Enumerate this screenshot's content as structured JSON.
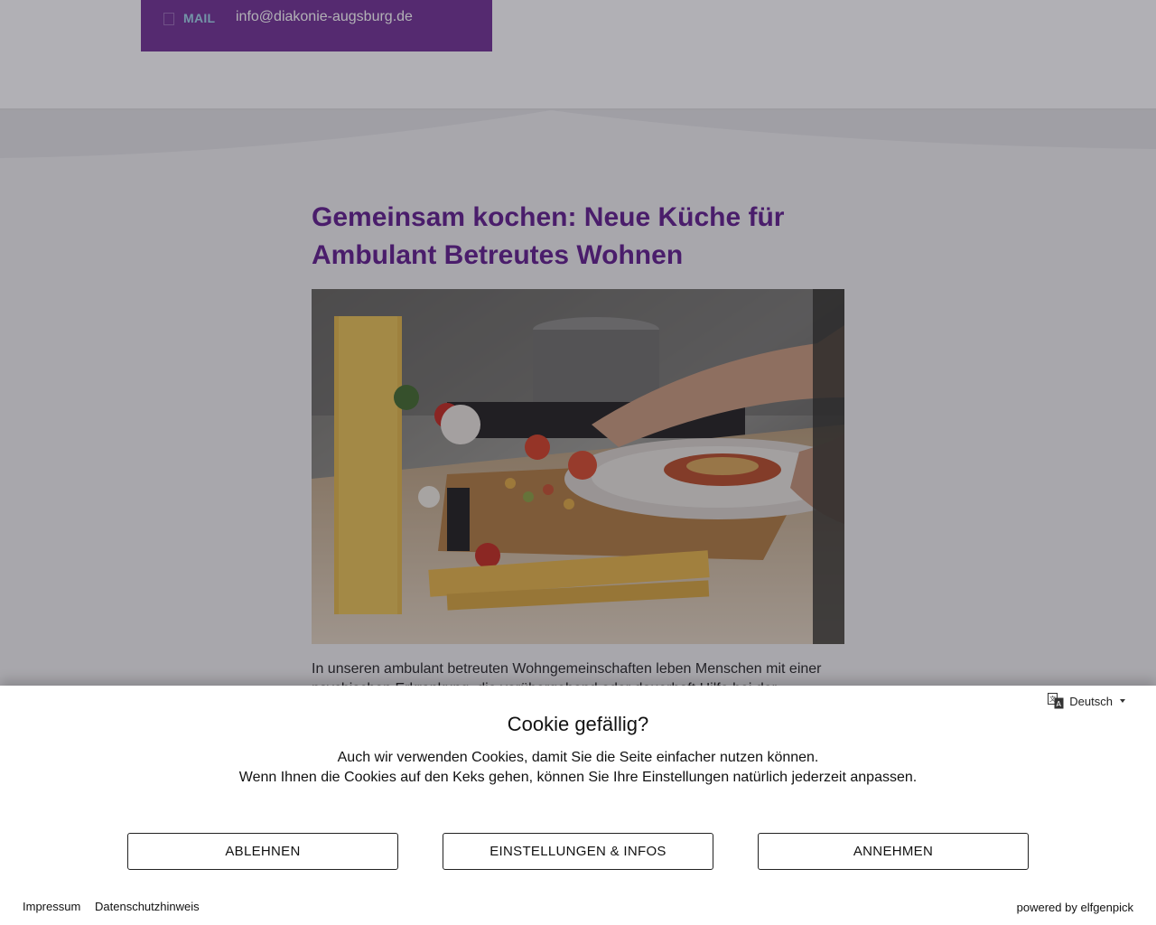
{
  "header": {
    "mail_label": "MAIL",
    "mail_address": "info@diakonie-augsburg.de",
    "icon": "mail-icon"
  },
  "article": {
    "title": "Gemeinsam kochen: Neue Küche für Ambulant Betreutes Wohnen",
    "intro": "In unseren ambulant betreuten Wohngemeinschaften leben Menschen mit einer psychischen Erkrankung, die vorübergehend oder dauerhaft Hilfe bei der"
  },
  "cookie_banner": {
    "title": "Cookie gefällig?",
    "text_line1": "Auch wir verwenden Cookies, damit Sie die Seite einfacher nutzen können.",
    "text_line2": "Wenn Ihnen die Cookies auf den Keks gehen, können Sie Ihre Einstellungen natürlich jederzeit anpassen.",
    "language": "Deutsch",
    "decline_label": "ABLEHNEN",
    "settings_label": "EINSTELLUNGEN & INFOS",
    "accept_label": "ANNEHMEN",
    "imprint_label": "Impressum",
    "privacy_label": "Datenschutzhinweis",
    "powered_by": "powered by elfgenpick"
  },
  "colors": {
    "brand_purple": "#6f2e93",
    "title_purple": "#5e1a8c",
    "mail_label_blue": "#9fd3ea"
  }
}
